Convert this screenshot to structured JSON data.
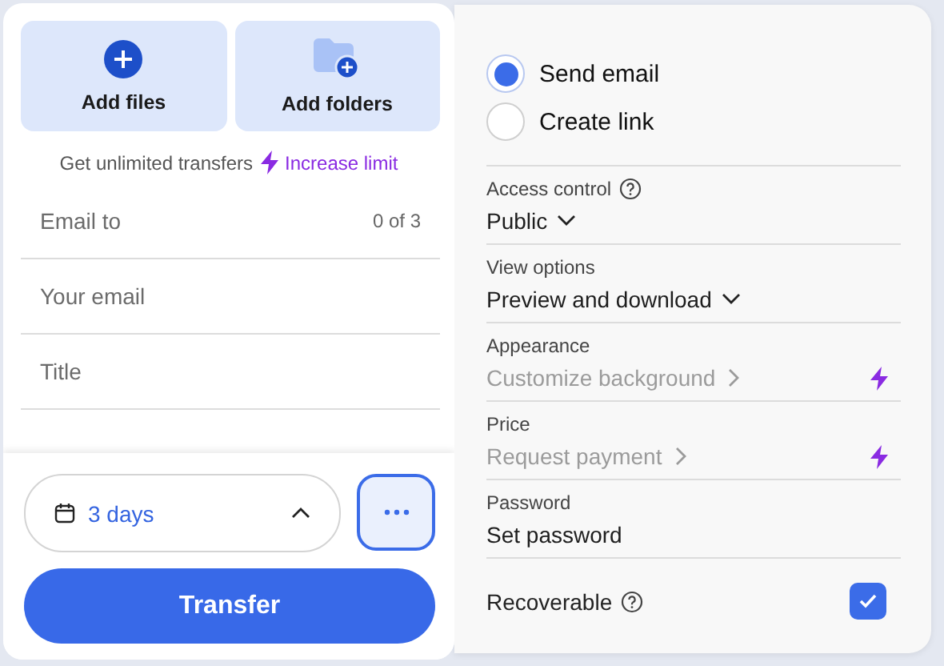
{
  "upload_buttons": [
    {
      "kind": "files",
      "label": "Add files"
    },
    {
      "kind": "folders",
      "label": "Add folders"
    }
  ],
  "promo": {
    "text": "Get unlimited transfers",
    "link": "Increase limit"
  },
  "fields": [
    {
      "placeholder": "Email to",
      "counter": "0 of 3"
    },
    {
      "placeholder": "Your email"
    },
    {
      "placeholder": "Title"
    }
  ],
  "expiry": {
    "value": "3 days",
    "expanded": true
  },
  "transfer_button": "Transfer",
  "delivery_options": [
    {
      "label": "Send email",
      "selected": true
    },
    {
      "label": "Create link",
      "selected": false
    }
  ],
  "settings": [
    {
      "label": "Access control",
      "help": true,
      "value": "Public",
      "kind": "dropdown",
      "disabled": false,
      "premium": false
    },
    {
      "label": "View options",
      "help": false,
      "value": "Preview and download",
      "kind": "dropdown",
      "disabled": false,
      "premium": false
    },
    {
      "label": "Appearance",
      "help": false,
      "value": "Customize background",
      "kind": "link",
      "disabled": true,
      "premium": true
    },
    {
      "label": "Price",
      "help": false,
      "value": "Request payment",
      "kind": "link",
      "disabled": true,
      "premium": true
    },
    {
      "label": "Password",
      "help": false,
      "value": "Set password",
      "kind": "text",
      "disabled": false,
      "premium": false
    }
  ],
  "recoverable": {
    "label": "Recoverable",
    "help": true,
    "checked": true
  }
}
